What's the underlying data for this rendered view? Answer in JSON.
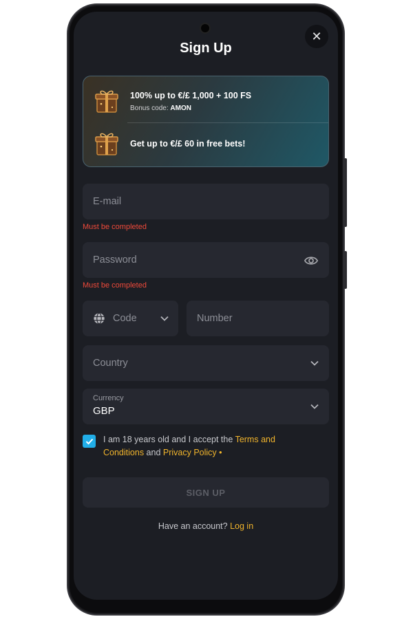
{
  "header": {
    "title": "Sign Up",
    "close": "✕"
  },
  "promo": [
    {
      "title": "100% up to €/£ 1,000 + 100 FS",
      "sub_label": "Bonus code:",
      "sub_code": "AMON",
      "icon": "gift-box-icon"
    },
    {
      "title": "Get up to €/£ 60 in free bets!",
      "icon": "gift-box-icon"
    }
  ],
  "form": {
    "email": {
      "placeholder": "E-mail",
      "error": "Must be completed"
    },
    "password": {
      "placeholder": "Password",
      "error": "Must be completed"
    },
    "code": {
      "placeholder": "Code"
    },
    "number": {
      "placeholder": "Number"
    },
    "country": {
      "placeholder": "Country"
    },
    "currency": {
      "label": "Currency",
      "value": "GBP"
    }
  },
  "terms": {
    "checked": true,
    "prefix": "I am 18 years old and I accept the ",
    "terms_link": "Terms and Conditions",
    "and": " and ",
    "privacy_link": "Privacy Policy",
    "suffix": " •"
  },
  "submit_label": "SIGN UP",
  "footer": {
    "prompt": "Have an account? ",
    "login_link": "Log in"
  },
  "colors": {
    "accent": "#f2b52c",
    "error": "#f04a3a",
    "checkbox": "#21aee8",
    "screen": "#1c1e24",
    "field": "#262830"
  }
}
